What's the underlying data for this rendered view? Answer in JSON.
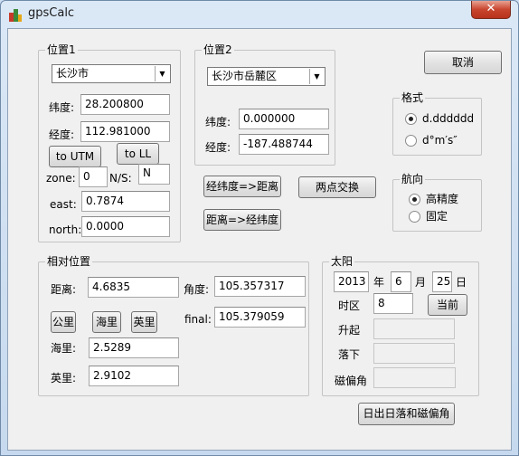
{
  "window": {
    "title": "gpsCalc",
    "close_glyph": "✕"
  },
  "cancel_label": "取消",
  "pos1": {
    "legend": "位置1",
    "combo_value": "长沙市",
    "lat_label": "纬度:",
    "lat_value": "28.200800",
    "lon_label": "经度:",
    "lon_value": "112.981000",
    "to_utm_label": "to UTM",
    "to_ll_label": "to LL",
    "zone_label": "zone:",
    "zone_value": "0",
    "ns_label": "N/S:",
    "ns_value": "N",
    "east_label": "east:",
    "east_value": "0.7874",
    "north_label": "north:",
    "north_value": "0.0000"
  },
  "pos2": {
    "legend": "位置2",
    "combo_value": "长沙市岳麓区",
    "lat_label": "纬度:",
    "lat_value": "0.000000",
    "lon_label": "经度:",
    "lon_value": "-187.488744"
  },
  "format": {
    "legend": "格式",
    "options": [
      "d.dddddd",
      "d°m′s″"
    ],
    "selected": 0
  },
  "heading": {
    "legend": "航向",
    "options": [
      "高精度",
      "固定"
    ],
    "selected": 0
  },
  "actions": {
    "latlon_to_dist": "经纬度=>距离",
    "swap_points": "两点交换",
    "dist_to_latlon": "距离=>经纬度"
  },
  "relative": {
    "legend": "相对位置",
    "dist_label": "距离:",
    "dist_value": "4.6835",
    "angle_label": "角度:",
    "angle_value": "105.357317",
    "km_label": "公里",
    "nmi_label": "海里",
    "mile_label": "英里",
    "final_label": "final:",
    "final_value": "105.379059",
    "nmi_row_label": "海里:",
    "nmi_value": "2.5289",
    "mile_row_label": "英里:",
    "mile_value": "2.9102"
  },
  "sun": {
    "legend": "太阳",
    "year_value": "2013",
    "year_label": "年",
    "month_value": "6",
    "month_label": "月",
    "day_value": "25",
    "day_label": "日",
    "tz_label": "时区",
    "tz_value": "8",
    "now_label": "当前",
    "rise_label": "升起",
    "rise_value": "",
    "set_label": "落下",
    "set_value": "",
    "declination_label": "磁偏角",
    "declination_value": ""
  },
  "sun_button_label": "日出日落和磁偏角"
}
